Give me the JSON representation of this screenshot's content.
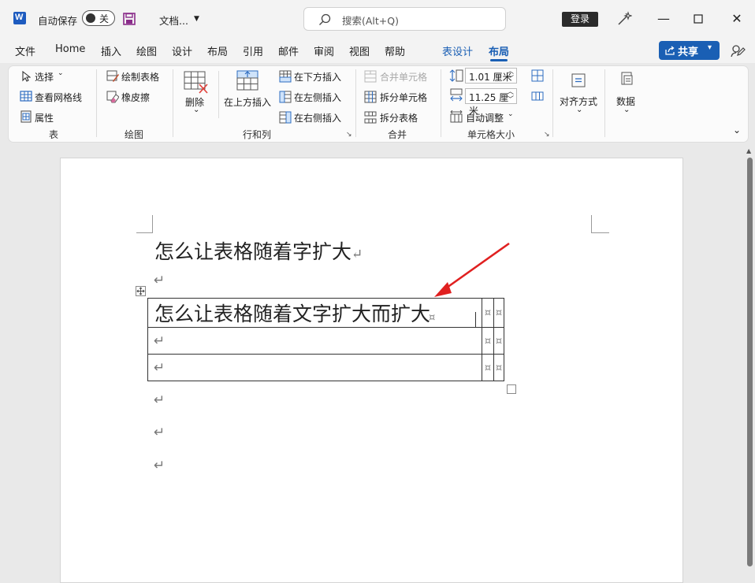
{
  "titlebar": {
    "autosave_label": "自动保存",
    "autosave_state": "关",
    "doc_name": "文档...",
    "search_placeholder": "搜索(Alt+Q)",
    "login": "登录",
    "window_icons": [
      "minimize-icon",
      "maximize-icon",
      "close-icon"
    ]
  },
  "menu": {
    "items": [
      "文件",
      "Home",
      "插入",
      "绘图",
      "设计",
      "布局",
      "引用",
      "邮件",
      "审阅",
      "视图",
      "帮助"
    ],
    "context_tabs": [
      "表设计",
      "布局"
    ],
    "active_tab": "布局",
    "share": "共享",
    "accent_color": "#1a5fb4"
  },
  "ribbon": {
    "table_group": {
      "select": "选择",
      "gridlines": "查看网格线",
      "properties": "属性",
      "label": "表"
    },
    "draw_group": {
      "draw_table": "绘制表格",
      "eraser": "橡皮擦",
      "label": "绘图"
    },
    "rows_cols_group": {
      "delete": "删除",
      "insert_above": "在上方插入",
      "insert_below": "在下方插入",
      "insert_left": "在左侧插入",
      "insert_right": "在右侧插入",
      "label": "行和列"
    },
    "merge_group": {
      "merge_cells": "合并单元格",
      "split_cells": "拆分单元格",
      "split_table": "拆分表格",
      "label": "合并"
    },
    "cell_size_group": {
      "height": "1.01 厘米",
      "width": "11.25 厘米",
      "autofit": "自动调整",
      "label": "单元格大小"
    },
    "alignment": "对齐方式",
    "data": "数据"
  },
  "document": {
    "heading": "怎么让表格随着字扩大",
    "para_mark": "↵",
    "table": {
      "rows": [
        [
          "怎么让表格随着文字扩大而扩大",
          "",
          ""
        ],
        [
          "",
          "",
          ""
        ],
        [
          "",
          "",
          ""
        ]
      ]
    },
    "annotation_arrow_color": "#e02020"
  }
}
